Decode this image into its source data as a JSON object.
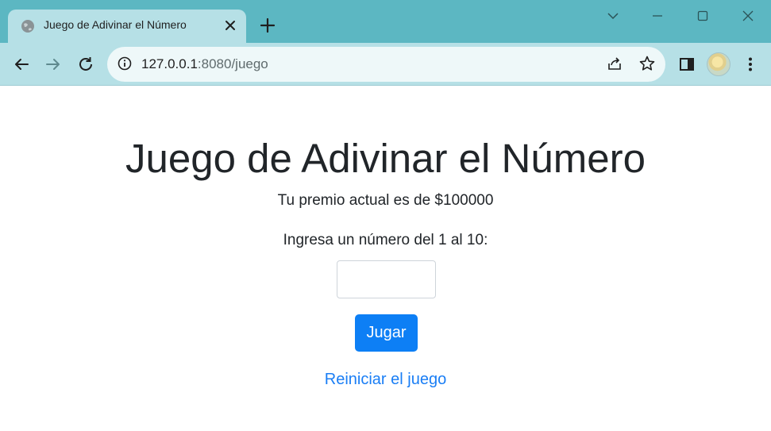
{
  "browser": {
    "tab_title": "Juego de Adivinar el Número",
    "url_host": "127.0.0.1",
    "url_path": ":8080/juego",
    "icons": [
      "globe-icon",
      "close-icon",
      "plus-icon",
      "chevron-down-icon",
      "minimize-icon",
      "maximize-icon",
      "window-close-icon",
      "back-arrow-icon",
      "forward-arrow-icon",
      "reload-icon",
      "info-icon",
      "share-icon",
      "star-icon",
      "side-panel-icon",
      "more-vert-icon"
    ]
  },
  "page": {
    "heading": "Juego de Adivinar el Número",
    "prize_text": "Tu premio actual es de $100000",
    "prompt_text": "Ingresa un número del 1 al 10:",
    "input_value": "",
    "play_button": "Jugar",
    "reset_link": "Reiniciar el juego"
  },
  "colors": {
    "titlebar": "#5cb7c2",
    "toolbar": "#b6e0e6",
    "button_primary": "#0d7ff5",
    "link": "#1a7ef5"
  }
}
